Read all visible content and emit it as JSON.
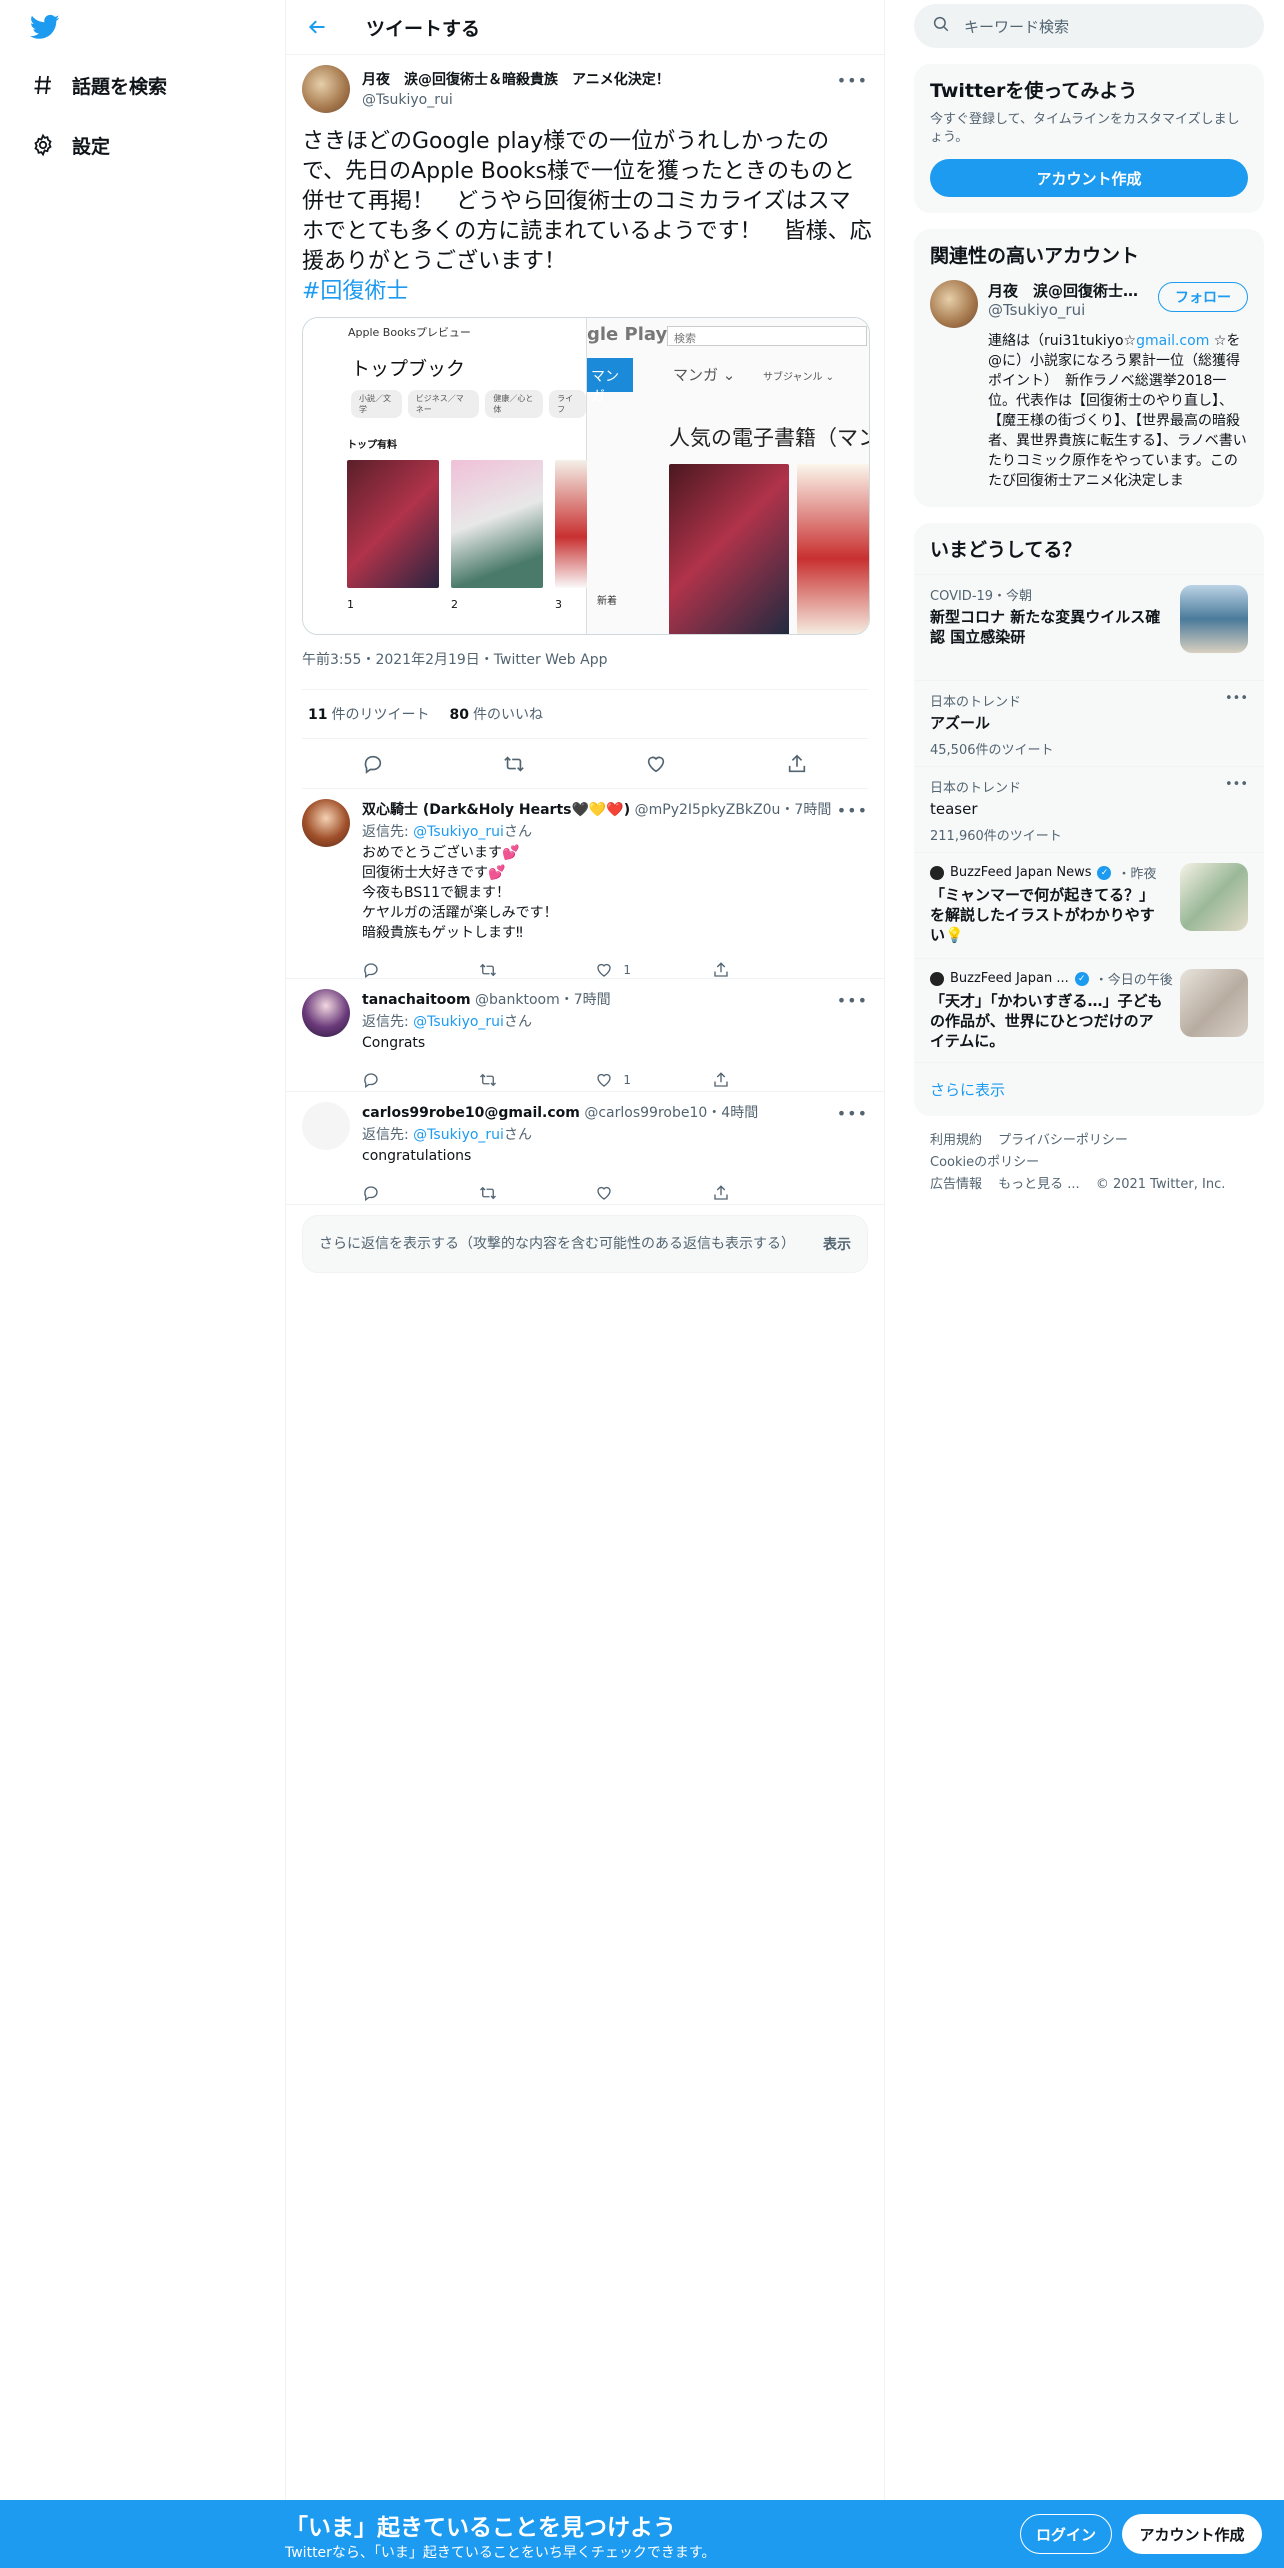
{
  "nav": {
    "logo_icon": "twitter-bird-icon",
    "items": [
      {
        "label": "話題を検索",
        "icon": "hashtag-icon"
      },
      {
        "label": "設定",
        "icon": "gear-icon"
      }
    ]
  },
  "header": {
    "title": "ツイートする"
  },
  "tweet": {
    "author_name": "月夜　涙@回復術士＆暗殺貴族　アニメ化決定！",
    "author_handle": "@Tsukiyo_rui",
    "text": "さきほどのGoogle play様での一位がうれしかったので、先日のApple Books様で一位を獲ったときのものと併せて再掲！　どうやら回復術士のコミカライズはスマホでとても多くの方に読まれているようです！　皆様、応援ありがとうございます！",
    "hashtag": "#回復術士",
    "media": {
      "left": {
        "app_label": "Apple Booksプレビュー",
        "heading": "トップブック",
        "chips": [
          "小説／文学",
          "ビジネス／マネー",
          "健康／心と体",
          "ライフ"
        ],
        "section": "トップ有料",
        "ranks": [
          "1",
          "2",
          "3"
        ]
      },
      "right": {
        "logo": "gle Play",
        "search_placeholder": "検索",
        "tab": "マンガ",
        "category": "マンガ ⌄",
        "subgenre": "サブジャンル ⌄",
        "heading": "人気の電子書籍（マン",
        "new_label": "新着"
      }
    },
    "timestamp": "午前3:55・2021年2月19日・Twitter Web App",
    "retweets": "11",
    "retweets_label": "件のリツイート",
    "likes": "80",
    "likes_label": "件のいいね"
  },
  "replies": [
    {
      "name": "双心騎士 (Dark&Holy Hearts🖤💛❤️)",
      "handle": "@mPy2I5pkyZBkZ0u",
      "time": "・7時間",
      "reply_prefix": "返信先: ",
      "reply_to": "@Tsukiyo_rui",
      "reply_suffix": "さん",
      "text": [
        "おめでとうございます💕",
        "回復術士大好きです💕",
        "今夜もBS11で観ます！",
        "ケヤルガの活躍が楽しみです！",
        "暗殺貴族もゲットします‼︎"
      ],
      "likes": "1"
    },
    {
      "name": "tanachaitoom",
      "handle": "@banktoom",
      "time": "・7時間",
      "reply_prefix": "返信先: ",
      "reply_to": "@Tsukiyo_rui",
      "reply_suffix": "さん",
      "text": [
        "Congrats"
      ],
      "likes": "1"
    },
    {
      "name": "carlos99robe10@gmail.com",
      "handle": "@carlos99robe10",
      "time": "・4時間",
      "reply_prefix": "返信先: ",
      "reply_to": "@Tsukiyo_rui",
      "reply_suffix": "さん",
      "text": [
        "congratulations"
      ],
      "likes": ""
    }
  ],
  "show_more": {
    "text": "さらに返信を表示する（攻撃的な内容を含む可能性のある返信も表示する）",
    "button": "表示"
  },
  "sidebar": {
    "search_placeholder": "キーワード検索",
    "try": {
      "title": "Twitterを使ってみよう",
      "desc": "今すぐ登録して、タイムラインをカスタマイズしましょう。",
      "button": "アカウント作成"
    },
    "related": {
      "title": "関連性の高いアカウント",
      "name": "月夜　涙@回復術士＆暗殺貴族　アニメ化決定！",
      "handle": "@Tsukiyo_rui",
      "follow": "フォロー",
      "bio_pre": "連絡は（rui31tukiyo☆",
      "bio_link": "gmail.com",
      "bio_post": " ☆を@に）小説家になろう累計一位（総獲得ポイント）　新作ラノベ総選挙2018一位。代表作は【回復術士のやり直し】、【魔王様の街づくり】、【世界最高の暗殺者、異世界貴族に転生する】、ラノベ書いたりコミック原作をやっています。このたび回復術士アニメ化決定しま"
    },
    "trends": {
      "title": "いまどうしてる？",
      "items": [
        {
          "context": "COVID-19・今朝",
          "title": "新型コロナ 新たな変異ウイルス確認 国立感染研"
        },
        {
          "context": "日本のトレンド",
          "title": "アズール",
          "count": "45,506件のツイート"
        },
        {
          "context": "日本のトレンド",
          "title": "teaser",
          "count": "211,960件のツイート"
        },
        {
          "source": "BuzzFeed Japan News",
          "time": "・昨夜",
          "title": "「ミャンマーで何が起きてる？」を解説したイラストがわかりやすい💡"
        },
        {
          "source": "BuzzFeed Japan ...",
          "time": "・今日の午後",
          "title": "「天才」「かわいすぎる…」子どもの作品が、世界にひとつだけのアイテムに。"
        }
      ],
      "show_more": "さらに表示"
    },
    "footer": [
      "利用規約",
      "プライバシーポリシー",
      "Cookieのポリシー",
      "広告情報",
      "もっと見る ...",
      "© 2021 Twitter, Inc."
    ]
  },
  "bottombar": {
    "main": "「いま」起きていることを見つけよう",
    "sub": "Twitterなら、「いま」起きていることをいち早くチェックできます。",
    "login": "ログイン",
    "signup": "アカウント作成"
  },
  "colors": {
    "accent": "#1d9bf0",
    "text": "#0f1419",
    "muted": "#536471",
    "panel": "#f7f9f9"
  }
}
